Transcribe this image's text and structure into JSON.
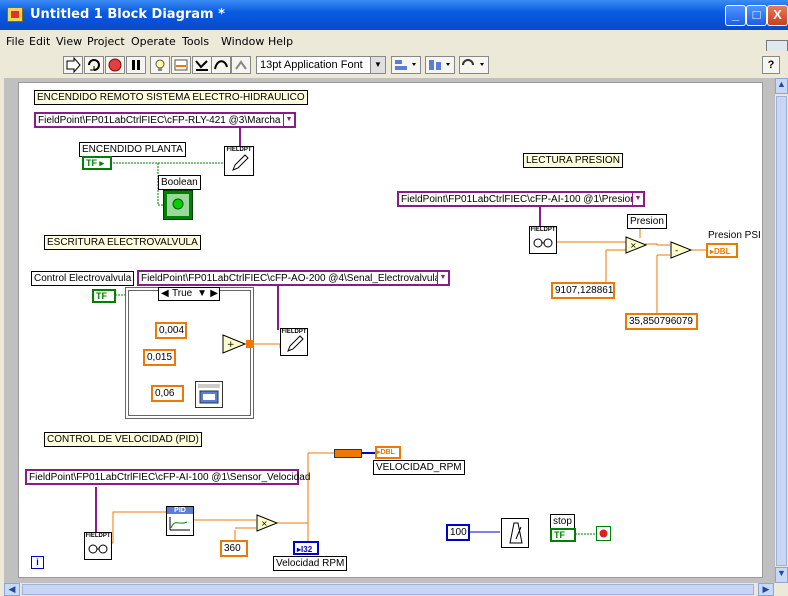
{
  "window": {
    "title": "Untitled 1 Block Diagram *",
    "controls": {
      "minimize": "_",
      "maximize": "□",
      "close": "X"
    }
  },
  "menu": [
    "File",
    "Edit",
    "View",
    "Project",
    "Operate",
    "Tools",
    "Window",
    "Help"
  ],
  "toolbar": {
    "font": "13pt Application Font",
    "help": "?",
    "icons": [
      "run-arrow-icon",
      "run-continuous-icon",
      "abort-icon",
      "pause-icon",
      "highlight-execution-icon",
      "retain-wire-values-icon",
      "step-into-icon",
      "step-over-icon",
      "step-out-icon",
      "align-objects-icon",
      "distribute-objects-icon",
      "reorder-icon"
    ]
  },
  "diagram": {
    "labels": {
      "encendido_remoto": "ENCENDIDO REMOTO SISTEMA ELECTRO-HIDRAULICO",
      "encendido_planta": "ENCENDIDO PLANTA",
      "boolean": "Boolean",
      "escritura": "ESCRITURA ELECTROVALVULA",
      "control_electrovalvula": "Control Electrovalvula",
      "lectura_presion": "LECTURA PRESION",
      "presion": "Presion",
      "presion_psi": "Presion PSI",
      "control_velocidad": "CONTROL DE VELOCIDAD (PID)",
      "velocidad_rpm_upper": "VELOCIDAD_RPM",
      "velocidad_rpm": "Velocidad RPM",
      "stop": "stop"
    },
    "fieldpoint": {
      "marcha": "FieldPoint\\FP01LabCtrlFIEC\\cFP-RLY-421 @3\\Marcha",
      "presion": "FieldPoint\\FP01LabCtrlFIEC\\cFP-AI-100 @1\\Presion",
      "electrovalvula": "FieldPoint\\FP01LabCtrlFIEC\\cFP-AO-200 @4\\Senal_Electrovalvula",
      "velocidad": "FieldPoint\\FP01LabCtrlFIEC\\cFP-AI-100 @1\\Sensor_Velocidad",
      "fieldpt_tag": "FIELDPT",
      "pid_tag": "PID"
    },
    "constants": {
      "c1": "9107,128861",
      "c2": "35,850796079",
      "c3": "0,004",
      "c4": "0,015",
      "c5": "0,06",
      "c6": "360",
      "c7": "100"
    },
    "case_selector": "True",
    "tf": "TF",
    "dbl": "DBL",
    "i32": "I32",
    "info": "i"
  },
  "colors": {
    "title_bar": "#0a5ce0",
    "numeric_wire": "#f07800",
    "refnum_wire": "#8b1a8b",
    "boolean_wire": "#008000",
    "integer_wire": "#0000cc"
  }
}
